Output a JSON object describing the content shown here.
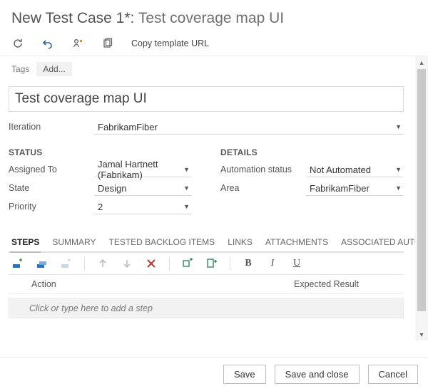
{
  "header": {
    "prefix": "New Test Case 1*:",
    "title": "Test coverage map UI"
  },
  "toolbar": {
    "copy_url": "Copy template URL"
  },
  "tags": {
    "label": "Tags",
    "add": "Add..."
  },
  "title_field": {
    "value": "Test coverage map UI"
  },
  "iteration": {
    "label": "Iteration",
    "value": "FabrikamFiber"
  },
  "status": {
    "heading": "STATUS",
    "fields": {
      "assigned_to": {
        "label": "Assigned To",
        "value": "Jamal Hartnett (Fabrikam)"
      },
      "state": {
        "label": "State",
        "value": "Design"
      },
      "priority": {
        "label": "Priority",
        "value": "2"
      }
    }
  },
  "details": {
    "heading": "DETAILS",
    "fields": {
      "automation": {
        "label": "Automation status",
        "value": "Not Automated"
      },
      "area": {
        "label": "Area",
        "value": "FabrikamFiber"
      }
    }
  },
  "tabs": {
    "items": [
      "STEPS",
      "SUMMARY",
      "TESTED BACKLOG ITEMS",
      "LINKS",
      "ATTACHMENTS",
      "ASSOCIATED AUTOMATION"
    ]
  },
  "steps": {
    "columns": {
      "action": "Action",
      "expected": "Expected Result"
    },
    "placeholder": "Click or type here to add a step"
  },
  "footer": {
    "save": "Save",
    "save_close": "Save and close",
    "cancel": "Cancel"
  }
}
